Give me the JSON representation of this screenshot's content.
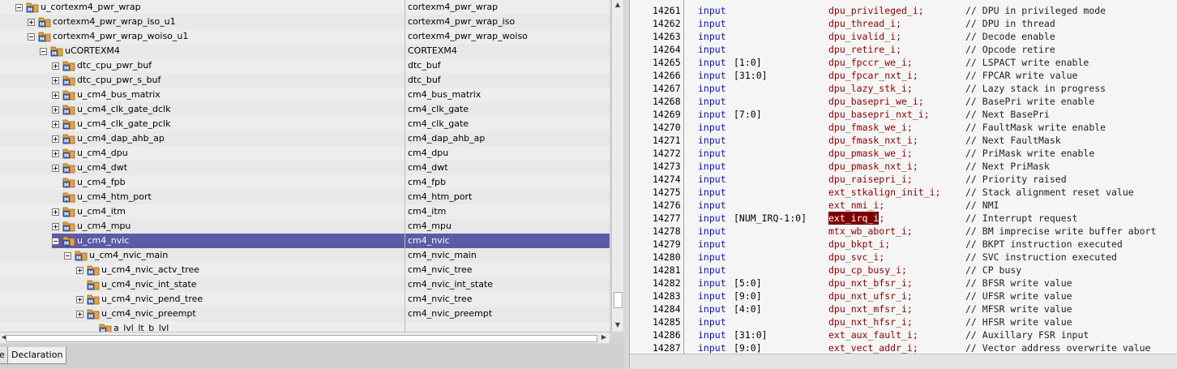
{
  "hierarchy": {
    "rows": [
      {
        "instance": "u_cortexm4_pwr_wrap",
        "module": "cortexm4_pwr_wrap",
        "level": 0,
        "expander": "minus"
      },
      {
        "instance": "cortexm4_pwr_wrap_iso_u1",
        "module": "cortexm4_pwr_wrap_iso",
        "level": 1,
        "expander": "plus"
      },
      {
        "instance": "cortexm4_pwr_wrap_woiso_u1",
        "module": "cortexm4_pwr_wrap_woiso",
        "level": 1,
        "expander": "minus"
      },
      {
        "instance": "uCORTEXM4",
        "module": "CORTEXM4",
        "level": 2,
        "expander": "minus"
      },
      {
        "instance": "dtc_cpu_pwr_buf",
        "module": "dtc_buf",
        "level": 3,
        "expander": "plus"
      },
      {
        "instance": "dtc_cpu_pwr_s_buf",
        "module": "dtc_buf",
        "level": 3,
        "expander": "plus"
      },
      {
        "instance": "u_cm4_bus_matrix",
        "module": "cm4_bus_matrix",
        "level": 3,
        "expander": "plus"
      },
      {
        "instance": "u_cm4_clk_gate_dclk",
        "module": "cm4_clk_gate",
        "level": 3,
        "expander": "plus"
      },
      {
        "instance": "u_cm4_clk_gate_pclk",
        "module": "cm4_clk_gate",
        "level": 3,
        "expander": "plus"
      },
      {
        "instance": "u_cm4_dap_ahb_ap",
        "module": "cm4_dap_ahb_ap",
        "level": 3,
        "expander": "plus"
      },
      {
        "instance": "u_cm4_dpu",
        "module": "cm4_dpu",
        "level": 3,
        "expander": "plus"
      },
      {
        "instance": "u_cm4_dwt",
        "module": "cm4_dwt",
        "level": 3,
        "expander": "plus"
      },
      {
        "instance": "u_cm4_fpb",
        "module": "cm4_fpb",
        "level": 3,
        "expander": "none"
      },
      {
        "instance": "u_cm4_htm_port",
        "module": "cm4_htm_port",
        "level": 3,
        "expander": "none"
      },
      {
        "instance": "u_cm4_itm",
        "module": "cm4_itm",
        "level": 3,
        "expander": "plus"
      },
      {
        "instance": "u_cm4_mpu",
        "module": "cm4_mpu",
        "level": 3,
        "expander": "plus"
      },
      {
        "instance": "u_cm4_nvic",
        "module": "cm4_nvic",
        "level": 3,
        "expander": "minus",
        "selected": true
      },
      {
        "instance": "u_cm4_nvic_main",
        "module": "cm4_nvic_main",
        "level": 4,
        "expander": "minus"
      },
      {
        "instance": "u_cm4_nvic_actv_tree",
        "module": "cm4_nvic_tree",
        "level": 5,
        "expander": "plus"
      },
      {
        "instance": "u_cm4_nvic_int_state",
        "module": "cm4_nvic_int_state",
        "level": 5,
        "expander": "none"
      },
      {
        "instance": "u_cm4_nvic_pend_tree",
        "module": "cm4_nvic_tree",
        "level": 5,
        "expander": "plus"
      },
      {
        "instance": "u_cm4_nvic_preempt",
        "module": "cm4_nvic_preempt",
        "level": 5,
        "expander": "plus"
      },
      {
        "instance": "a_lvl_lt_b_lvl",
        "module": "",
        "level": 6,
        "expander": "none",
        "partial": true
      }
    ]
  },
  "tabs": {
    "first_fragment": "e",
    "declaration": "Declaration"
  },
  "code": {
    "colors": {
      "keyword": "#1010c8",
      "signal": "#8b0000",
      "highlight_bg": "#7b0000"
    },
    "lines": [
      {
        "n": "14261",
        "kw": "input",
        "range": "",
        "sig": "dpu_privileged_i;",
        "cmt": "// DPU in privileged mode"
      },
      {
        "n": "14262",
        "kw": "input",
        "range": "",
        "sig": "dpu_thread_i;",
        "cmt": "// DPU in thread"
      },
      {
        "n": "14263",
        "kw": "input",
        "range": "",
        "sig": "dpu_ivalid_i;",
        "cmt": "// Decode enable"
      },
      {
        "n": "14264",
        "kw": "input",
        "range": "",
        "sig": "dpu_retire_i;",
        "cmt": "// Opcode retire"
      },
      {
        "n": "14265",
        "kw": "input",
        "range": "[1:0]",
        "sig": "dpu_fpccr_we_i;",
        "cmt": "// LSPACT write enable"
      },
      {
        "n": "14266",
        "kw": "input",
        "range": "[31:0]",
        "sig": "dpu_fpcar_nxt_i;",
        "cmt": "// FPCAR write value"
      },
      {
        "n": "14267",
        "kw": "input",
        "range": "",
        "sig": "dpu_lazy_stk_i;",
        "cmt": "// Lazy stack in progress"
      },
      {
        "n": "14268",
        "kw": "input",
        "range": "",
        "sig": "dpu_basepri_we_i;",
        "cmt": "// BasePri write enable"
      },
      {
        "n": "14269",
        "kw": "input",
        "range": "[7:0]",
        "sig": "dpu_basepri_nxt_i;",
        "cmt": "// Next BasePri"
      },
      {
        "n": "14270",
        "kw": "input",
        "range": "",
        "sig": "dpu_fmask_we_i;",
        "cmt": "// FaultMask write enable"
      },
      {
        "n": "14271",
        "kw": "input",
        "range": "",
        "sig": "dpu_fmask_nxt_i;",
        "cmt": "// Next FaultMask"
      },
      {
        "n": "14272",
        "kw": "input",
        "range": "",
        "sig": "dpu_pmask_we_i;",
        "cmt": "// PriMask write enable"
      },
      {
        "n": "14273",
        "kw": "input",
        "range": "",
        "sig": "dpu_pmask_nxt_i;",
        "cmt": "// Next PriMask"
      },
      {
        "n": "14274",
        "kw": "input",
        "range": "",
        "sig": "dpu_raisepri_i;",
        "cmt": "// Priority raised"
      },
      {
        "n": "14275",
        "kw": "input",
        "range": "",
        "sig": "ext_stkalign_init_i;",
        "cmt": "// Stack alignment reset value"
      },
      {
        "n": "14276",
        "kw": "input",
        "range": "",
        "sig": "ext_nmi_i;",
        "cmt": "// NMI"
      },
      {
        "n": "14277",
        "kw": "input",
        "range": "[NUM_IRQ-1:0]",
        "sig": "ext_irq_i",
        "sig_tail": ";",
        "cmt": "// Interrupt request",
        "highlight": true
      },
      {
        "n": "14278",
        "kw": "input",
        "range": "",
        "sig": "mtx_wb_abort_i;",
        "cmt": "// BM imprecise write buffer abort"
      },
      {
        "n": "14279",
        "kw": "input",
        "range": "",
        "sig": "dpu_bkpt_i;",
        "cmt": "// BKPT instruction executed"
      },
      {
        "n": "14280",
        "kw": "input",
        "range": "",
        "sig": "dpu_svc_i;",
        "cmt": "// SVC instruction executed"
      },
      {
        "n": "14281",
        "kw": "input",
        "range": "",
        "sig": "dpu_cp_busy_i;",
        "cmt": "// CP busy"
      },
      {
        "n": "14282",
        "kw": "input",
        "range": "[5:0]",
        "sig": "dpu_nxt_bfsr_i;",
        "cmt": "// BFSR write value"
      },
      {
        "n": "14283",
        "kw": "input",
        "range": "[9:0]",
        "sig": "dpu_nxt_ufsr_i;",
        "cmt": "// UFSR write value"
      },
      {
        "n": "14284",
        "kw": "input",
        "range": "[4:0]",
        "sig": "dpu_nxt_mfsr_i;",
        "cmt": "// MFSR write value"
      },
      {
        "n": "14285",
        "kw": "input",
        "range": "",
        "sig": "dpu_nxt_hfsr_i;",
        "cmt": "// HFSR write value"
      },
      {
        "n": "14286",
        "kw": "input",
        "range": "[31:0]",
        "sig": "ext_aux_fault_i;",
        "cmt": "// Auxillary FSR input"
      },
      {
        "n": "14287",
        "kw": "input",
        "range": "[9:0]",
        "sig": "ext_vect_addr_i;",
        "cmt": "// Vector address overwrite value"
      }
    ]
  }
}
